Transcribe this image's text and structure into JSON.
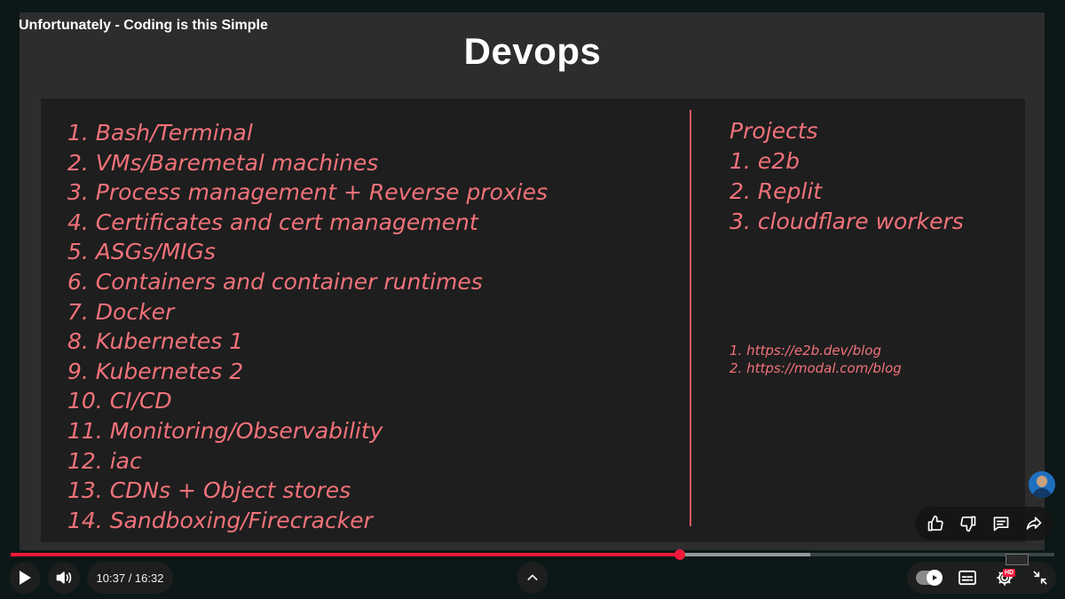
{
  "player": {
    "video_title": "Unfortunately - Coding is this Simple",
    "current_time": "10:37",
    "duration": "16:32",
    "time_display": "10:37 / 16:32",
    "progress_fraction": 0.6415,
    "buffered_fraction": 0.7663,
    "hd_badge": "HD",
    "accent_color": "#f1193b"
  },
  "slide": {
    "heading": "Devops",
    "ink_color": "#f2727a",
    "topics": [
      "1. Bash/Terminal",
      "2. VMs/Baremetal machines",
      "3. Process management + Reverse proxies",
      "4. Certificates and cert management",
      "5. ASGs/MIGs",
      "6. Containers and container runtimes",
      "7. Docker",
      "8. Kubernetes 1",
      "9. Kubernetes 2",
      "10. CI/CD",
      "11. Monitoring/Observability",
      "12. iac",
      "13. CDNs + Object stores",
      "14. Sandboxing/Firecracker"
    ],
    "projects_title": "Projects",
    "projects": [
      "1. e2b",
      "2. Replit",
      "3. cloudflare workers"
    ],
    "links": [
      "1. https://e2b.dev/blog",
      "2. https://modal.com/blog"
    ]
  },
  "actions": {
    "like_icon": "thumbs-up-icon",
    "dislike_icon": "thumbs-down-icon",
    "comments_icon": "comment-icon",
    "share_icon": "share-icon"
  },
  "controls": {
    "play_icon": "play-icon",
    "volume_icon": "volume-icon",
    "chapters_icon": "chevron-up-icon",
    "autoplay_icon": "autoplay-toggle-icon",
    "captions_icon": "captions-icon",
    "settings_icon": "gear-icon",
    "exit_fullscreen_icon": "exit-fullscreen-icon"
  }
}
